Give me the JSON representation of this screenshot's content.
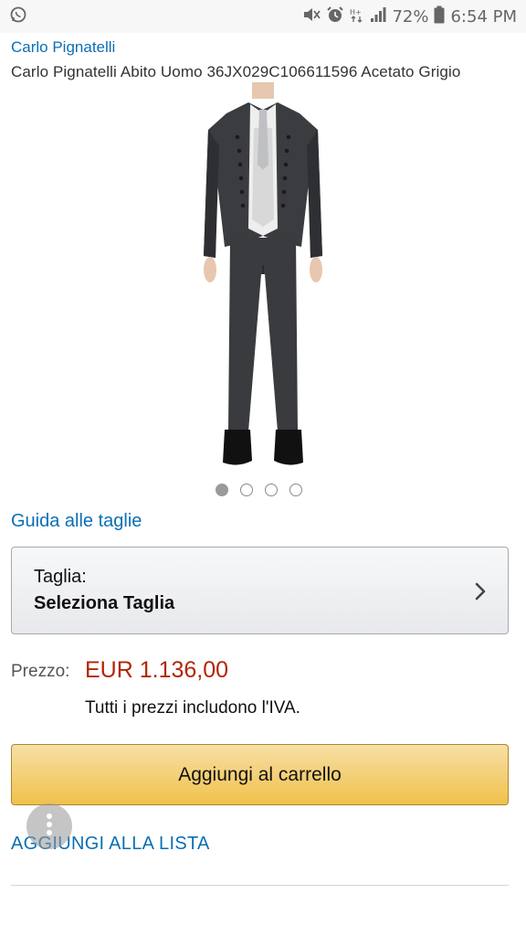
{
  "status_bar": {
    "battery": "72%",
    "time": "6:54 PM",
    "icons": [
      "whatsapp-icon",
      "mute-icon",
      "alarm-icon",
      "data-icon",
      "signal-icon",
      "battery-icon"
    ]
  },
  "product": {
    "brand": "Carlo Pignatelli",
    "title": "Carlo Pignatelli Abito Uomo 36JX029C106611596 Acetato Grigio",
    "image_pages": 4,
    "active_image": 1
  },
  "size_guide_link": "Guida alle taglie",
  "size_selector": {
    "label": "Taglia:",
    "value": "Seleziona Taglia"
  },
  "price": {
    "label": "Prezzo:",
    "value": "EUR 1.136,00",
    "vat_note": "Tutti i prezzi includono l'IVA."
  },
  "add_to_cart_label": "Aggiungi al carrello",
  "add_to_list_label": "AGGIUNGI ALLA LISTA",
  "colors": {
    "link": "#0a6fb5",
    "price": "#b12704",
    "cart_button": "#f0c14b"
  }
}
